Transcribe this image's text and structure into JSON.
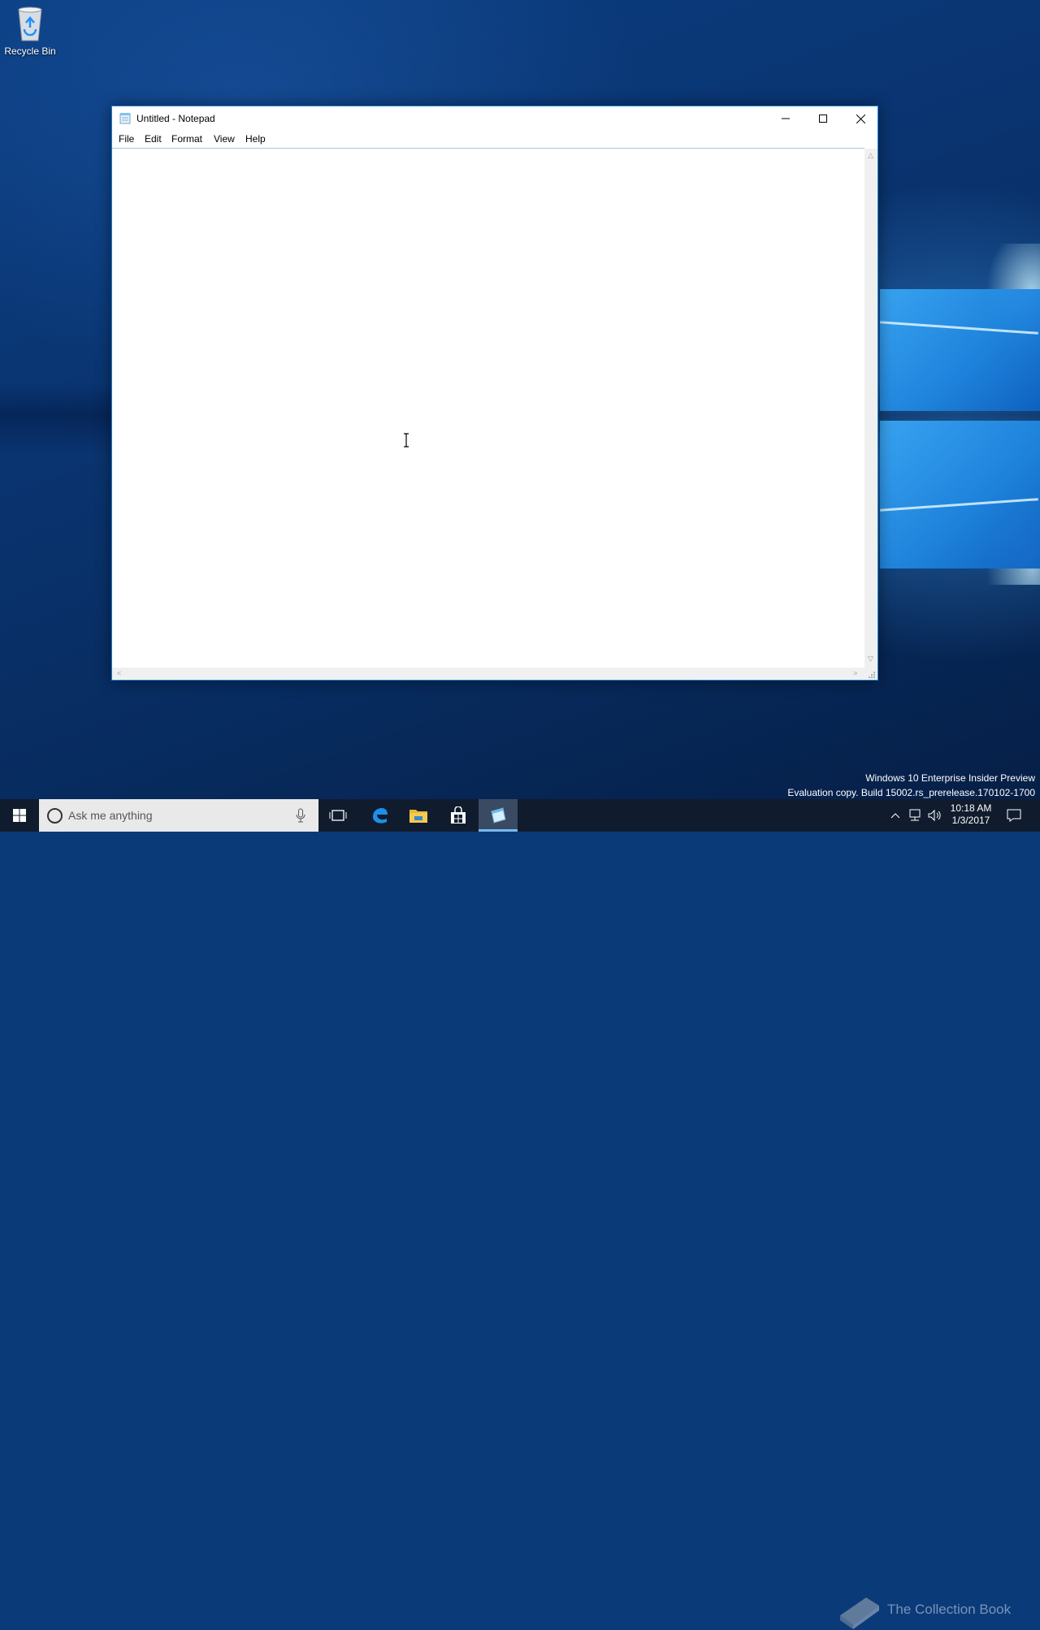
{
  "desktop": {
    "icons": [
      {
        "label": "Recycle Bin",
        "icon": "recycle-bin-icon"
      }
    ]
  },
  "window": {
    "title": "Untitled - Notepad",
    "menu": [
      "File",
      "Edit",
      "Format",
      "View",
      "Help"
    ],
    "editor_value": "",
    "controls": {
      "minimize": "minimize-icon",
      "maximize": "maximize-icon",
      "close": "close-icon"
    }
  },
  "watermark": {
    "line1": "Windows 10 Enterprise Insider Preview",
    "line2": "Evaluation copy. Build 15002.rs_prerelease.170102-1700"
  },
  "taskbar": {
    "search_placeholder": "Ask me anything",
    "pinned": [
      "task-view-icon",
      "edge-icon",
      "file-explorer-icon",
      "store-icon",
      "notepad-icon"
    ],
    "clock_time": "10:18 AM",
    "clock_date": "1/3/2017",
    "overlay_text": "The Collection Book"
  },
  "colors": {
    "accent": "#1883d7",
    "taskbar": "#101c2e",
    "wallpaper": "#0a3a78"
  }
}
